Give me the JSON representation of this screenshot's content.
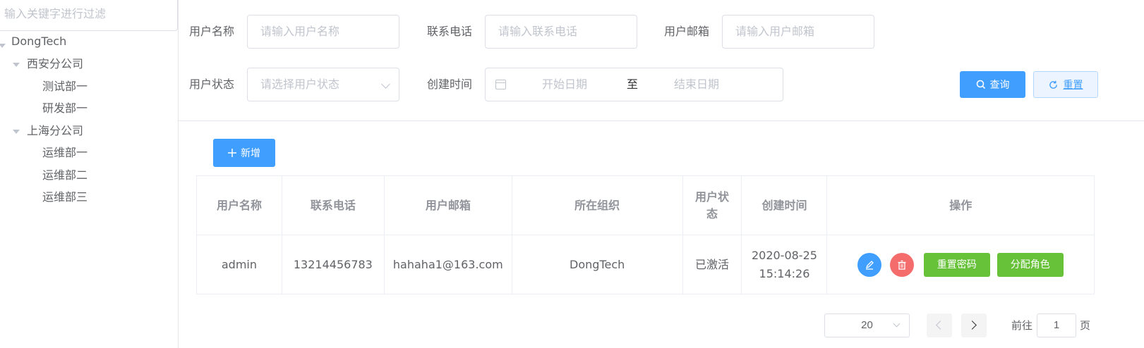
{
  "tree": {
    "filter_placeholder": "输入关键字进行过滤",
    "nodes": [
      {
        "label": "DongTech"
      },
      {
        "label": "西安分公司"
      },
      {
        "label": "测试部一"
      },
      {
        "label": "研发部一"
      },
      {
        "label": "上海分公司"
      },
      {
        "label": "运维部一"
      },
      {
        "label": "运维部二"
      },
      {
        "label": "运维部三"
      }
    ]
  },
  "search": {
    "username_label": "用户名称",
    "username_placeholder": "请输入用户名称",
    "phone_label": "联系电话",
    "phone_placeholder": "请输入联系电话",
    "email_label": "用户邮箱",
    "email_placeholder": "请输入用户邮箱",
    "status_label": "用户状态",
    "status_placeholder": "请选择用户状态",
    "created_label": "创建时间",
    "start_placeholder": "开始日期",
    "range_separator": "至",
    "end_placeholder": "结束日期",
    "query_button": "查询",
    "reset_button": "重置"
  },
  "toolbar": {
    "add_button": "新增"
  },
  "table": {
    "headers": [
      "用户名称",
      "联系电话",
      "用户邮箱",
      "所在组织",
      "用户状态",
      "创建时间",
      "操作"
    ],
    "rows": [
      {
        "username": "admin",
        "phone": "13214456783",
        "email": "hahaha1@163.com",
        "org": "DongTech",
        "status": "已激活",
        "created_date": "2020-08-25",
        "created_time": "15:14:26",
        "reset_pwd": "重置密码",
        "assign_role": "分配角色"
      }
    ]
  },
  "pagination": {
    "page_size": "20",
    "goto_label": "前往",
    "page": "1",
    "page_suffix": "页"
  }
}
